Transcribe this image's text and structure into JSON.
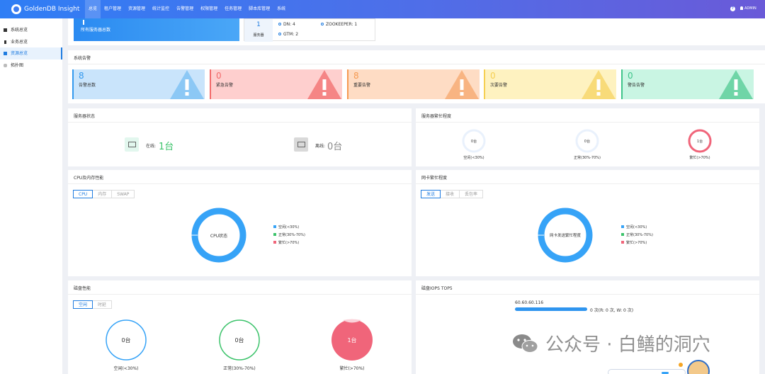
{
  "app": {
    "brand": "GoldenDB Insight",
    "user": "ADMIN"
  },
  "nav": [
    "总览",
    "租户管理",
    "资源管理",
    "统计监控",
    "告警管理",
    "权限管理",
    "任务管理",
    "脚本库管理",
    "系统"
  ],
  "sidebar": {
    "items": [
      {
        "label": "系统总览",
        "active": false
      },
      {
        "label": "业务总览",
        "active": false
      },
      {
        "label": "资源总览",
        "active": true
      },
      {
        "label": "拓扑图",
        "active": false
      }
    ]
  },
  "top_summary": {
    "banner_label": "所有服务器总数",
    "server_count": "1",
    "server_label": "服务器",
    "items": [
      "DN: 4",
      "ZOOKEEPER: 1",
      "GTM: 2"
    ]
  },
  "alarms": {
    "title": "系统告警",
    "items": [
      {
        "count": "8",
        "label": "告警总数",
        "bg": "#c9e4fb",
        "accent": "#3399ee",
        "tri": "#8cc8f5"
      },
      {
        "count": "0",
        "label": "紧急告警",
        "bg": "#fecfce",
        "accent": "#f26a6a",
        "tri": "#f58585"
      },
      {
        "count": "8",
        "label": "重要告警",
        "bg": "#fedcc4",
        "accent": "#f59a52",
        "tri": "#f8b482"
      },
      {
        "count": "0",
        "label": "次要告警",
        "bg": "#fef2c0",
        "accent": "#f5cf52",
        "tri": "#f8db79"
      },
      {
        "count": "0",
        "label": "警告告警",
        "bg": "#c9f5e3",
        "accent": "#3fc48a",
        "tri": "#6fd5a7"
      }
    ]
  },
  "server_status": {
    "title": "服务器状态",
    "online_label": "在线:",
    "online_value": "1台",
    "offline_label": "离线:",
    "offline_value": "0台"
  },
  "server_busy": {
    "title": "服务器繁忙程度",
    "rings": [
      {
        "value": "0台",
        "label": "空闲(<30%)"
      },
      {
        "value": "0台",
        "label": "正常(30%-70%)"
      },
      {
        "value": "1台",
        "label": "繁忙(>70%)"
      }
    ]
  },
  "cpu": {
    "title": "CPU及内存性能",
    "tabs": [
      "CPU",
      "内存",
      "SWAP"
    ],
    "center": "CPU状态",
    "legend": [
      "空闲(<30%)",
      "正常(30%-70%)",
      "繁忙(>70%)"
    ]
  },
  "nic": {
    "title": "网卡繁忙程度",
    "tabs": [
      "发送",
      "接收",
      "丢包率"
    ],
    "center": "网卡发送繁忙程度",
    "legend": [
      "空闲(<30%)",
      "正常(30%-70%)",
      "繁忙(>70%)"
    ]
  },
  "disk": {
    "title": "磁盘性能",
    "tabs": [
      "空闲",
      "时延"
    ],
    "rings": [
      {
        "value": "0台",
        "label": "空闲(<30%)"
      },
      {
        "value": "0台",
        "label": "正常(30%-70%)"
      },
      {
        "value": "1台",
        "label": "繁忙(>70%)"
      }
    ]
  },
  "iops": {
    "title": "磁盘IOPS TOP5",
    "rows": [
      {
        "host": "60.60.60.116",
        "value": "0 次(R: 0 次, W: 0 次)",
        "fill": 1.0
      }
    ]
  },
  "watermark": "公众号 · 白鳝的洞穴",
  "colors": {
    "blue": "#36a3f7",
    "green": "#3cc36b",
    "red": "#f0657a",
    "ring_light": "#e9f1fc"
  }
}
